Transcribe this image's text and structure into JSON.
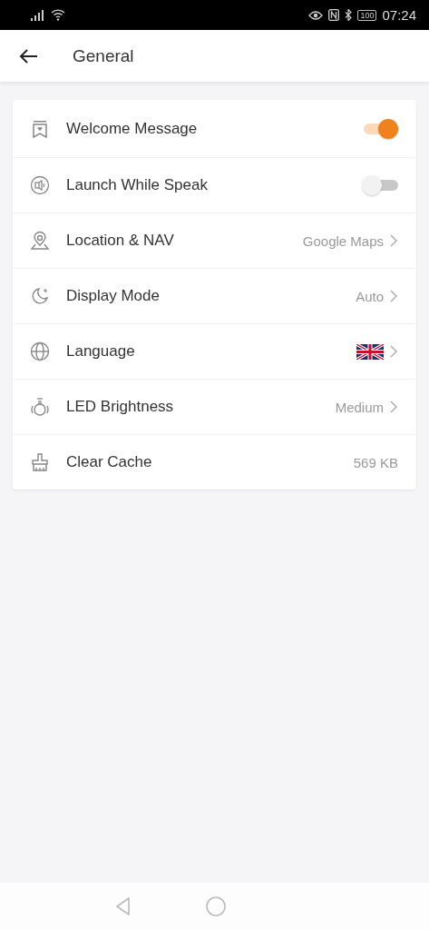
{
  "status_bar": {
    "battery": "100",
    "time": "07:24"
  },
  "header": {
    "title": "General"
  },
  "settings": [
    {
      "label": "Welcome Message",
      "kind": "toggle",
      "on": true
    },
    {
      "label": "Launch While Speak",
      "kind": "toggle",
      "on": false
    },
    {
      "label": "Location & NAV",
      "kind": "link",
      "value": "Google Maps"
    },
    {
      "label": "Display Mode",
      "kind": "link",
      "value": "Auto"
    },
    {
      "label": "Language",
      "kind": "flag"
    },
    {
      "label": "LED Brightness",
      "kind": "link",
      "value": "Medium"
    },
    {
      "label": "Clear Cache",
      "kind": "value",
      "value": "569 KB"
    }
  ]
}
